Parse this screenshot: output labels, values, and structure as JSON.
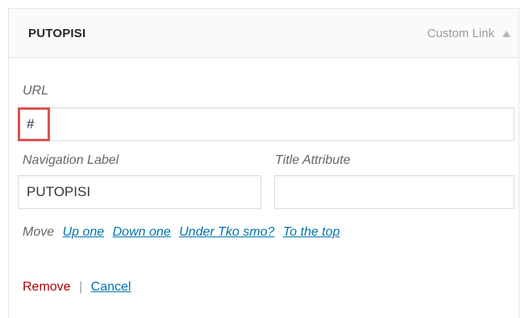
{
  "item": {
    "title": "PUTOPISI",
    "type_label": "Custom Link"
  },
  "url_field": {
    "label": "URL",
    "value": "#"
  },
  "nav_label_field": {
    "label": "Navigation Label",
    "value": "PUTOPISI"
  },
  "title_attr_field": {
    "label": "Title Attribute",
    "value": ""
  },
  "move": {
    "label": "Move",
    "links": [
      "Up one",
      "Down one",
      "Under Tko smo?",
      "To the top"
    ]
  },
  "actions": {
    "remove": "Remove",
    "separator": "|",
    "cancel": "Cancel"
  },
  "icons": {
    "toggle": "arrow-up-icon"
  },
  "colors": {
    "link": "#0073aa",
    "remove": "#aa0000",
    "highlight": "#d9534f"
  }
}
